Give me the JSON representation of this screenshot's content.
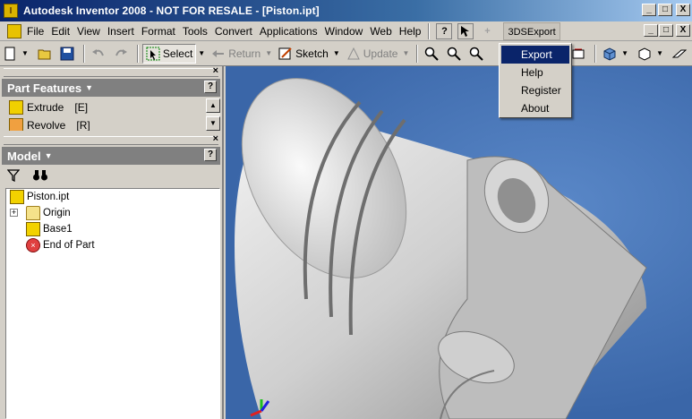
{
  "window": {
    "title": "Autodesk Inventor 2008 - NOT FOR RESALE - [Piston.ipt]",
    "controls": {
      "minimize": "_",
      "maximize": "□",
      "close": "X"
    }
  },
  "menubar": {
    "items": [
      {
        "label": "File"
      },
      {
        "label": "Edit"
      },
      {
        "label": "View"
      },
      {
        "label": "Insert"
      },
      {
        "label": "Format"
      },
      {
        "label": "Tools"
      },
      {
        "label": "Convert"
      },
      {
        "label": "Applications"
      },
      {
        "label": "Window"
      },
      {
        "label": "Web"
      },
      {
        "label": "Help"
      }
    ],
    "help_icon": "?",
    "plugin_menu": "3DSExport"
  },
  "toolbar": {
    "select_label": "Select",
    "return_label": "Return",
    "sketch_label": "Sketch",
    "update_label": "Update"
  },
  "part_features": {
    "title": "Part Features",
    "help": "?",
    "items": [
      {
        "label": "Extrude",
        "key": "[E]"
      },
      {
        "label": "Revolve",
        "key": "[R]"
      }
    ]
  },
  "model": {
    "title": "Model",
    "help": "?",
    "tree": [
      {
        "label": "Piston.ipt",
        "icon": "part-icon",
        "level": 0
      },
      {
        "label": "Origin",
        "icon": "folder-icon",
        "level": 1,
        "expander": "+"
      },
      {
        "label": "Base1",
        "icon": "part-icon",
        "level": 1
      },
      {
        "label": "End of Part",
        "icon": "end-of-part-icon",
        "level": 1
      }
    ]
  },
  "plugin_dropdown": {
    "items": [
      {
        "label": "Export",
        "active": true
      },
      {
        "label": "Help"
      },
      {
        "label": "Register"
      },
      {
        "label": "About"
      }
    ]
  },
  "colors": {
    "title_active": "#0a246a",
    "viewport_bg": "#3a66a8",
    "selection": "#0a246a"
  }
}
